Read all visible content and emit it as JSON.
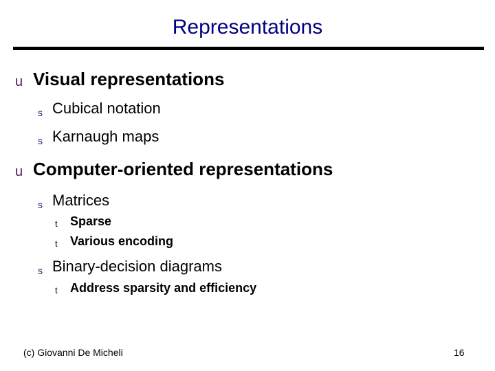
{
  "slide": {
    "title": "Representations",
    "bullets": {
      "level1": "u",
      "level2": "s",
      "level3": "t"
    },
    "items": [
      {
        "level": 1,
        "text": "Visual representations"
      },
      {
        "level": 2,
        "text": "Cubical notation"
      },
      {
        "level": 2,
        "text": "Karnaugh maps"
      },
      {
        "level": 1,
        "text": "Computer-oriented representations"
      },
      {
        "level": 2,
        "text": "Matrices"
      },
      {
        "level": 3,
        "text": "Sparse"
      },
      {
        "level": 3,
        "text": "Various encoding"
      },
      {
        "level": 2,
        "text": "Binary-decision diagrams"
      },
      {
        "level": 3,
        "text": "Address sparsity and efficiency"
      }
    ],
    "footer": {
      "copyright": "(c)  Giovanni De Micheli",
      "page_number": "16"
    },
    "colors": {
      "title": "#000080",
      "divider": "#000000",
      "text": "#000000"
    }
  }
}
